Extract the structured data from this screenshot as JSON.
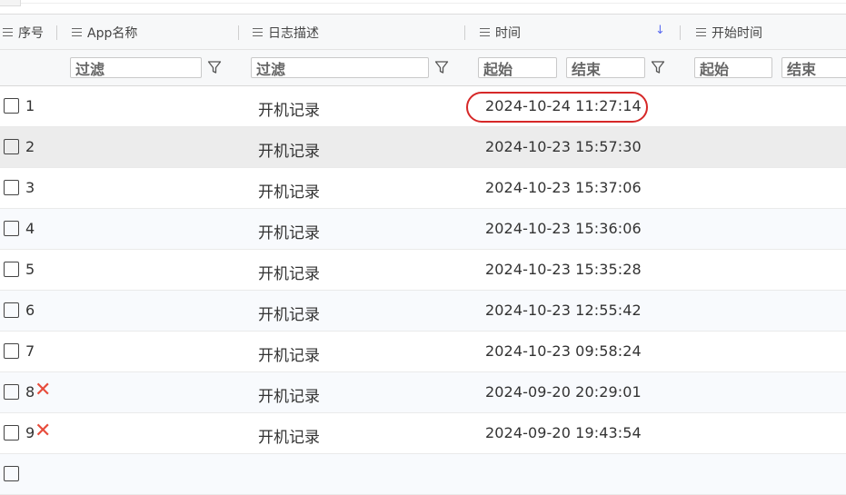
{
  "columns": [
    {
      "label": "序号"
    },
    {
      "label": "App名称"
    },
    {
      "label": "日志描述"
    },
    {
      "label": "时间"
    },
    {
      "label": "开始时间"
    }
  ],
  "filters": {
    "filter_text": "过滤",
    "start_text": "起始",
    "end_text": "结束"
  },
  "rows": [
    {
      "num": "1",
      "desc": "开机记录",
      "time": "2024-10-24 11:27:14",
      "flag": ""
    },
    {
      "num": "2",
      "desc": "开机记录",
      "time": "2024-10-23 15:57:30",
      "flag": ""
    },
    {
      "num": "3",
      "desc": "开机记录",
      "time": "2024-10-23 15:37:06",
      "flag": ""
    },
    {
      "num": "4",
      "desc": "开机记录",
      "time": "2024-10-23 15:36:06",
      "flag": ""
    },
    {
      "num": "5",
      "desc": "开机记录",
      "time": "2024-10-23 15:35:28",
      "flag": ""
    },
    {
      "num": "6",
      "desc": "开机记录",
      "time": "2024-10-23 12:55:42",
      "flag": ""
    },
    {
      "num": "7",
      "desc": "开机记录",
      "time": "2024-10-23 09:58:24",
      "flag": ""
    },
    {
      "num": "8",
      "desc": "开机记录",
      "time": "2024-09-20 20:29:01",
      "flag": "✕"
    },
    {
      "num": "9",
      "desc": "开机记录",
      "time": "2024-09-20 19:43:54",
      "flag": "✕"
    },
    {
      "num": "",
      "desc": "",
      "time": "",
      "flag": ""
    }
  ],
  "colors": {
    "highlight": "#d62828",
    "error_mark": "#e74c3c",
    "sort_accent": "#5b6cf0"
  },
  "icons": {
    "column_menu": "menu-lines-icon",
    "sort": "arrow-down-icon",
    "filter": "funnel-icon",
    "row_flag": "red-x-icon"
  }
}
